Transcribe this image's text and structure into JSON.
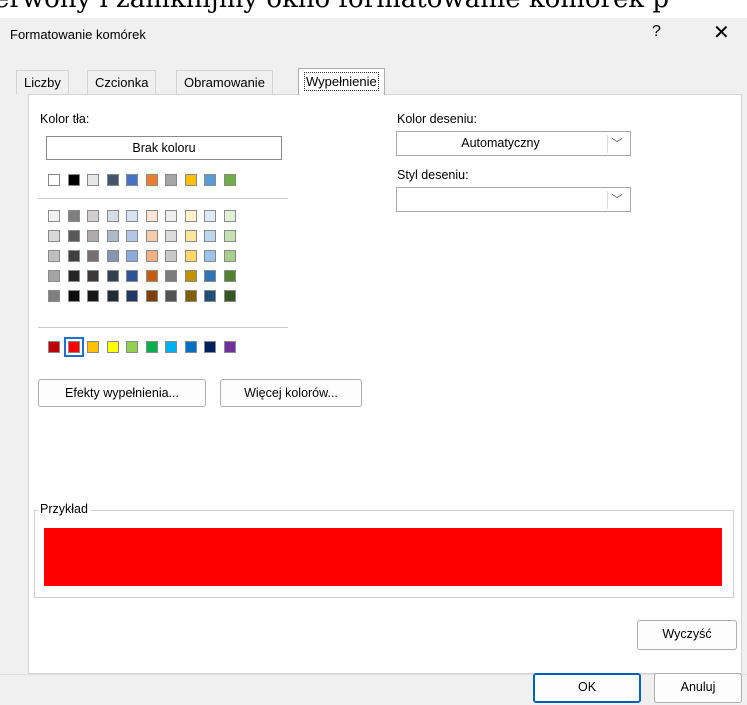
{
  "background_text": "erwony i zamknijmy okno formatowanie komórek p",
  "dialog": {
    "title": "Formatowanie komórek",
    "help_glyph": "?",
    "close_glyph": "✕"
  },
  "tabs": [
    {
      "label": "Liczby"
    },
    {
      "label": "Czcionka"
    },
    {
      "label": "Obramowanie"
    },
    {
      "label": "Wypełnienie"
    }
  ],
  "fill": {
    "background_color_label": "Kolor tła:",
    "no_color_label": "Brak koloru",
    "theme_top_row": [
      "#ffffff",
      "#000000",
      "#e7e6e6",
      "#44546a",
      "#4472c4",
      "#ed7d31",
      "#a5a5a5",
      "#ffc000",
      "#5b9bd5",
      "#70ad47"
    ],
    "theme_shades": [
      [
        "#f2f2f2",
        "#7f7f7f",
        "#d0cece",
        "#d6dce4",
        "#d9e2f3",
        "#fbe5d5",
        "#ededed",
        "#fff2cc",
        "#deebf6",
        "#e2efd9"
      ],
      [
        "#d8d8d8",
        "#595959",
        "#aeabab",
        "#adb9ca",
        "#b4c6e7",
        "#f7cbac",
        "#dbdbdb",
        "#fee599",
        "#bdd7ee",
        "#c5e0b3"
      ],
      [
        "#bfbfbf",
        "#3f3f3f",
        "#757070",
        "#8496b0",
        "#8eaadb",
        "#f4b183",
        "#c9c9c9",
        "#ffd965",
        "#9dc3e6",
        "#a8d08d"
      ],
      [
        "#a5a5a5",
        "#262626",
        "#3a3838",
        "#323f4f",
        "#2f5496",
        "#c55a11",
        "#7b7b7b",
        "#bf9000",
        "#2e75b5",
        "#538135"
      ],
      [
        "#7f7f7f",
        "#0c0c0c",
        "#171616",
        "#222a35",
        "#1f3864",
        "#833c0b",
        "#525252",
        "#7f6000",
        "#1f4e79",
        "#375623"
      ]
    ],
    "standard_colors": [
      "#c00000",
      "#ff0000",
      "#ffc000",
      "#ffff00",
      "#92d050",
      "#00b050",
      "#00b0f0",
      "#0070c0",
      "#002060",
      "#7030a0"
    ],
    "selected_standard_index": 1,
    "fill_effects_label": "Efekty wypełnienia...",
    "more_colors_label": "Więcej kolorów...",
    "pattern_color_label": "Kolor deseniu:",
    "pattern_color_value": "Automatyczny",
    "pattern_style_label": "Styl deseniu:",
    "pattern_style_value": ""
  },
  "sample": {
    "label": "Przykład",
    "color": "#ff0000"
  },
  "buttons": {
    "clear_label": "Wyczyść",
    "ok_label": "OK",
    "cancel_label": "Anuluj"
  }
}
